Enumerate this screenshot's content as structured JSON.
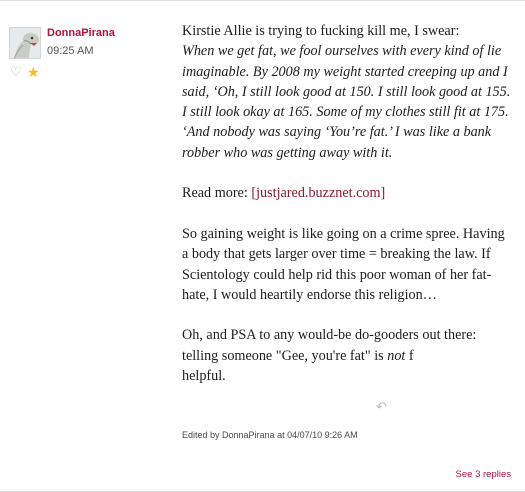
{
  "author": {
    "name": "DonnaPirana",
    "time": "09:25 AM",
    "heart_icon": "heart-outline-icon",
    "star_icon": "star-icon"
  },
  "post": {
    "intro": "Kirstie Allie is trying to fucking kill me, I swear:",
    "quote": "When we get fat, we fool ourselves with every kind of lie imaginable. By 2008 my weight started creeping up and I said, ‘Oh, I still look good at 150. I still look good at 155. I still look okay at 165. Some of my clothes still fit at 175. ‘And nobody was saying ‘You’re fat.’ I was like a bank robber who was getting away with it.",
    "read_more_label": "Read more:",
    "read_more_link": "[justjared.buzznet.com]",
    "paragraph2": "So gaining weight is like going on a crime spree. Having a body that gets larger over time = breaking the law. If Scientology could help rid this poor woman of her fat-hate, I would heartily endorse this religion…",
    "paragraph3_a": "Oh, and PSA to any would-be do-gooders out there: telling someone \"Gee, you're fat\" is ",
    "paragraph3_em": "not",
    "paragraph3_b": " f",
    "paragraph3_c": "helpful."
  },
  "edited": "Edited by DonnaPirana at 04/07/10 9:26 AM",
  "replies_label": "See 3 replies",
  "colors": {
    "username": "#b5123b",
    "link": "#8b1a2e",
    "star": "#f3be20"
  }
}
